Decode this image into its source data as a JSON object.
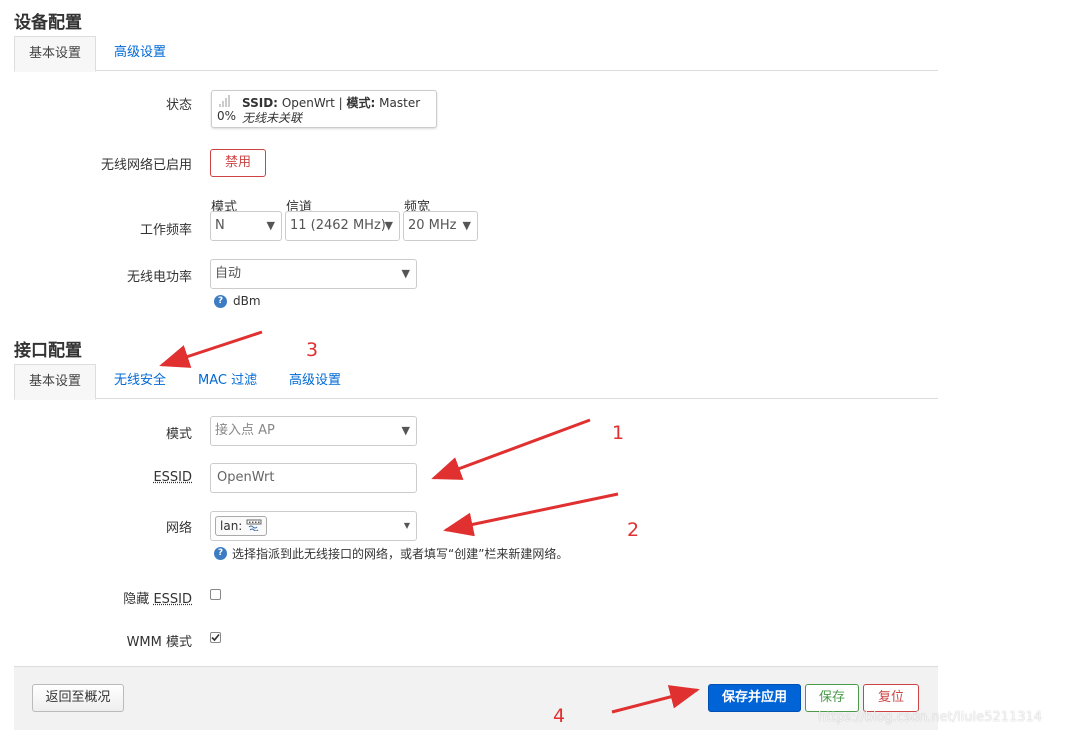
{
  "device": {
    "title": "设备配置",
    "tabs": [
      "基本设置",
      "高级设置"
    ],
    "status_label": "状态",
    "status_percent": "0%",
    "status_ssid_key": "SSID:",
    "status_ssid_val": "OpenWrt |",
    "status_mode_key": "模式:",
    "status_mode_val": "Master",
    "status_assoc": "无线未关联",
    "wireless_enabled_label": "无线网络已启用",
    "disable_button": "禁用",
    "freq_label": "工作频率",
    "mode_caption": "模式",
    "mode_value": "N",
    "channel_caption": "信道",
    "channel_value": "11 (2462 MHz)",
    "width_caption": "频宽",
    "width_value": "20 MHz",
    "txpower_label": "无线电功率",
    "txpower_value": "自动",
    "txpower_unit": "dBm"
  },
  "iface": {
    "title": "接口配置",
    "tabs": [
      "基本设置",
      "无线安全",
      "MAC 过滤",
      "高级设置"
    ],
    "mode_label": "模式",
    "mode_value": "接入点 AP",
    "essid_label": "ESSID",
    "essid_value": "OpenWrt",
    "network_label": "网络",
    "network_value": "lan:",
    "network_help": "选择指派到此无线接口的网络，或者填写“创建”栏来新建网络。",
    "hidden_label_prefix": "隐藏 ",
    "hidden_label_essid": "ESSID",
    "wmm_label": "WMM 模式"
  },
  "footer": {
    "back_button": "返回至概况",
    "save_apply_button": "保存并应用",
    "save_button": "保存",
    "reset_button": "复位"
  },
  "annotations": [
    "1",
    "2",
    "3",
    "4"
  ],
  "watermark": "https://blog.csdn.net/liule5211314",
  "colors": {
    "accent": "#0063d6",
    "danger": "#cc4444",
    "success": "#4a9a4a",
    "annotation": "#e03030"
  }
}
